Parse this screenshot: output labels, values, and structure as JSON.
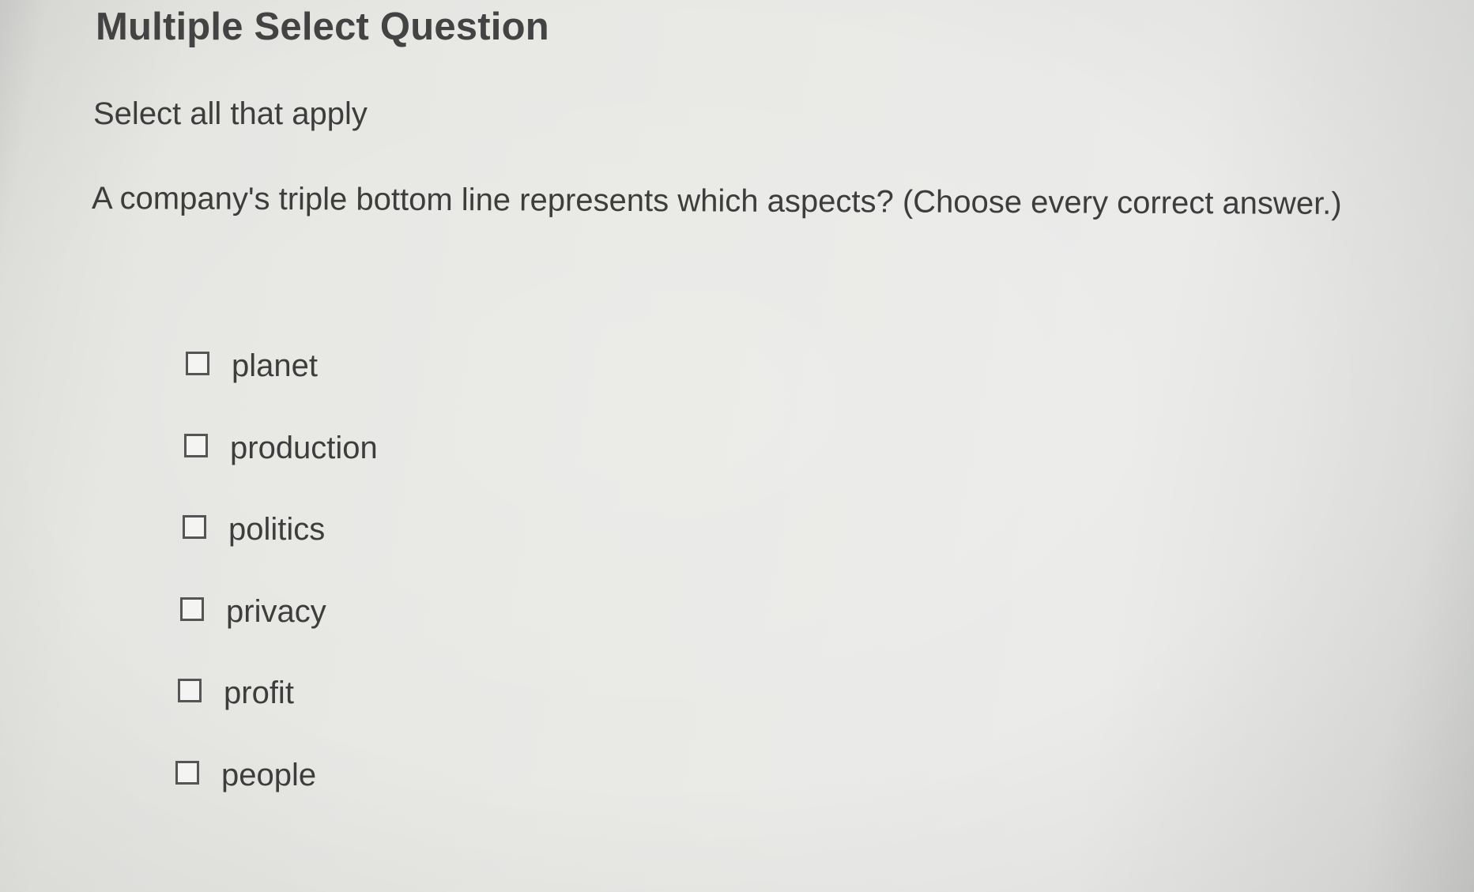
{
  "header": {
    "title": "Multiple Select Question",
    "instruction": "Select all that apply"
  },
  "question": {
    "text": "A company's triple bottom line represents which aspects? (Choose every correct answer.)"
  },
  "options": [
    {
      "label": "planet",
      "checked": false
    },
    {
      "label": "production",
      "checked": false
    },
    {
      "label": "politics",
      "checked": false
    },
    {
      "label": "privacy",
      "checked": false
    },
    {
      "label": "profit",
      "checked": false
    },
    {
      "label": "people",
      "checked": false
    }
  ]
}
